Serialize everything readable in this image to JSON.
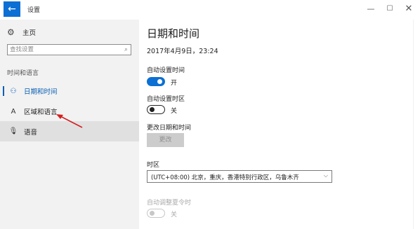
{
  "window": {
    "title": "设置",
    "back_icon": "←",
    "minimize_icon": "—",
    "maximize_icon": "☐",
    "close_icon": "✕"
  },
  "sidebar": {
    "home": {
      "icon": "⚙",
      "label": "主页"
    },
    "search": {
      "placeholder": "查找设置",
      "icon": "⌕"
    },
    "section_label": "时间和语言",
    "items": [
      {
        "icon": "⚇",
        "label": "日期和时间",
        "active": true
      },
      {
        "icon": "A",
        "label": "区域和语言",
        "active": false
      },
      {
        "icon": "🎙",
        "label": "语音",
        "active": false
      }
    ]
  },
  "main": {
    "title": "日期和时间",
    "current_time": "2017年4月9日，23:24",
    "auto_time": {
      "label": "自动设置时间",
      "state": "开",
      "on": true
    },
    "auto_timezone": {
      "label": "自动设置时区",
      "state": "关",
      "on": false
    },
    "change_datetime": {
      "label": "更改日期和时间",
      "button": "更改"
    },
    "timezone": {
      "label": "时区",
      "value": "(UTC+08:00) 北京，重庆，香港特别行政区，乌鲁木齐",
      "chevron": "⌵"
    },
    "dst": {
      "label": "自动调整夏令时",
      "state": "关",
      "on": false,
      "disabled": true
    }
  },
  "colors": {
    "accent": "#0c6fd3",
    "sidebar_bg": "#f2f2f2",
    "annotation_arrow": "#d42020"
  }
}
